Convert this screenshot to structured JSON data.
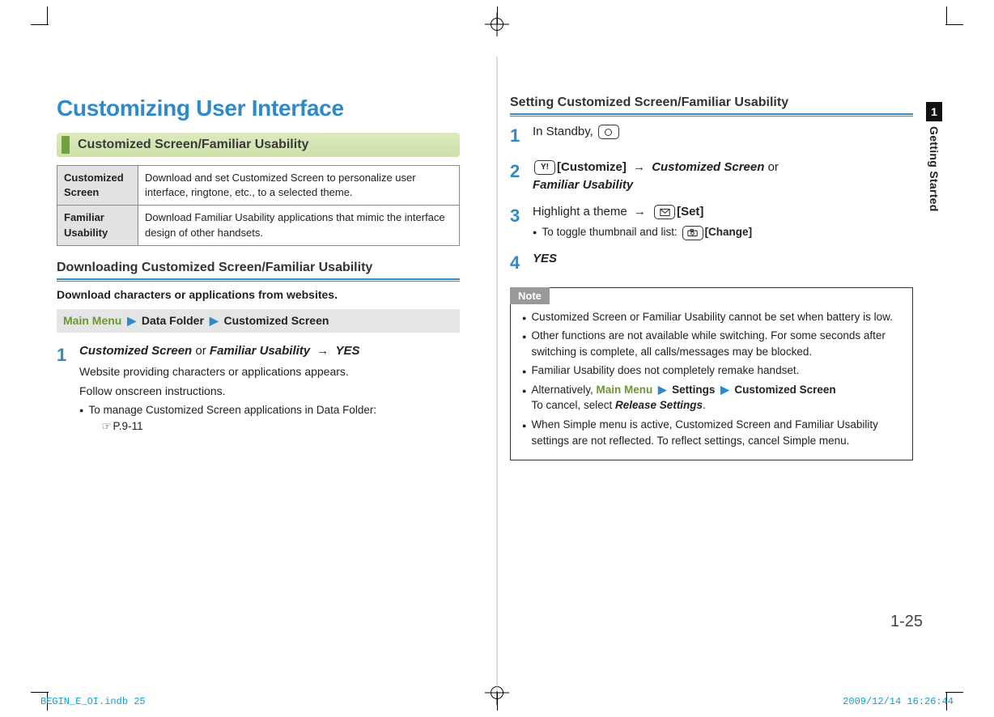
{
  "title": "Customizing User Interface",
  "section1": {
    "heading": "Customized Screen/Familiar Usability",
    "table": [
      {
        "term": "Customized Screen",
        "desc": "Download and set Customized Screen to personalize user interface, ringtone, etc., to a selected theme."
      },
      {
        "term": "Familiar Usability",
        "desc": "Download Familiar Usability applications that mimic the interface design of other handsets."
      }
    ]
  },
  "download": {
    "heading": "Downloading Customized Screen/Familiar Usability",
    "intro": "Download characters or applications from websites.",
    "crumb": {
      "root": "Main Menu",
      "a": "Data Folder",
      "b": "Customized Screen"
    },
    "step1": {
      "opt_a": "Customized Screen",
      "opt_or": "or",
      "opt_b": "Familiar Usability",
      "arrow": "→",
      "yes": "YES",
      "desc1": "Website providing characters or applications appears.",
      "desc2": "Follow onscreen instructions.",
      "bullet": "To manage Customized Screen applications in Data Folder:",
      "ref": "P.9-11"
    }
  },
  "setting": {
    "heading": "Setting Customized Screen/Familiar Usability",
    "s1": {
      "text": "In Standby,"
    },
    "s2": {
      "customize": "[Customize]",
      "arrow": "→",
      "opt_a": "Customized Screen",
      "opt_or": "or",
      "opt_b": "Familiar Usability"
    },
    "s3": {
      "text_a": "Highlight a theme",
      "arrow": "→",
      "set": "[Set]",
      "bullet": "To toggle thumbnail and list:",
      "change": "[Change]"
    },
    "s4": {
      "yes": "YES"
    }
  },
  "note": {
    "label": "Note",
    "items": [
      "Customized Screen or Familiar Usability cannot be set when battery is low.",
      "Other functions are not available while switching. For some seconds after switching is complete, all calls/messages may be blocked.",
      "Familiar Usability does not completely remake handset."
    ],
    "alt_prefix": "Alternatively,",
    "alt_root": "Main Menu",
    "alt_a": "Settings",
    "alt_b": "Customized Screen",
    "alt_line2a": "To cancel, select",
    "alt_line2b": "Release Settings",
    "last": "When Simple menu is active, Customized Screen and Familiar Usability settings are not reflected. To reflect settings, cancel Simple menu."
  },
  "side": {
    "num": "1",
    "name": "Getting Started"
  },
  "page_number": "1-25",
  "footer": {
    "left": "BEGIN_E_OI.indb   25",
    "right": "2009/12/14   16:26:44"
  }
}
